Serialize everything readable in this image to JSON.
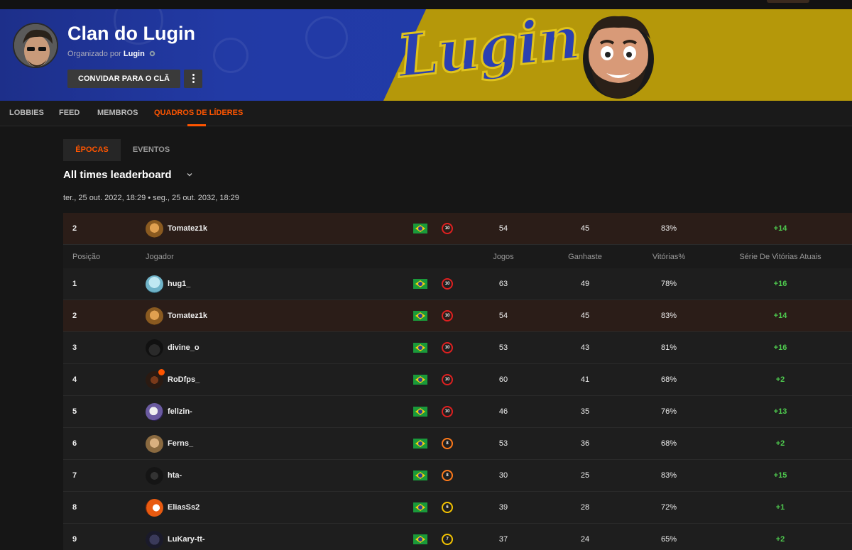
{
  "clan": {
    "title": "Clan do Lugin",
    "organized_by_prefix": "Organizado por",
    "organizer": "Lugin",
    "invite_button": "CONVIDAR PARA O CLÃ",
    "banner_brand": "Lugin"
  },
  "nav": {
    "tabs": [
      {
        "label": "LOBBIES"
      },
      {
        "label": "FEED"
      },
      {
        "label": "MEMBROS"
      },
      {
        "label": "QUADROS DE LÍDERES"
      }
    ],
    "active": "QUADROS DE LÍDERES"
  },
  "subtabs": [
    {
      "label": "ÉPOCAS"
    },
    {
      "label": "EVENTOS"
    }
  ],
  "leaderboard": {
    "title": "All times leaderboard",
    "range": "ter., 25 out. 2022, 18:29 • seg., 25 out. 2032, 18:29",
    "columns": {
      "position": "Posição",
      "player": "Jogador",
      "games": "Jogos",
      "won": "Ganhaste",
      "win_pct": "Vitórias%",
      "streak": "Série De Vitórias Atuais"
    },
    "current_user": {
      "pos": "2",
      "name": "Tomatez1k",
      "level": "10",
      "games": "54",
      "won": "45",
      "pct": "83%",
      "streak": "+14"
    },
    "rows": [
      {
        "pos": "1",
        "name": "hug1_",
        "level": "10",
        "games": "63",
        "won": "49",
        "pct": "78%",
        "streak": "+16"
      },
      {
        "pos": "2",
        "name": "Tomatez1k",
        "level": "10",
        "games": "54",
        "won": "45",
        "pct": "83%",
        "streak": "+14"
      },
      {
        "pos": "3",
        "name": "divine_o",
        "level": "10",
        "games": "53",
        "won": "43",
        "pct": "81%",
        "streak": "+16"
      },
      {
        "pos": "4",
        "name": "RoDfps_",
        "level": "10",
        "games": "60",
        "won": "41",
        "pct": "68%",
        "streak": "+2"
      },
      {
        "pos": "5",
        "name": "fellzin-",
        "level": "10",
        "games": "46",
        "won": "35",
        "pct": "76%",
        "streak": "+13"
      },
      {
        "pos": "6",
        "name": "Ferns_",
        "level": "8",
        "games": "53",
        "won": "36",
        "pct": "68%",
        "streak": "+2"
      },
      {
        "pos": "7",
        "name": "hta-",
        "level": "8",
        "games": "30",
        "won": "25",
        "pct": "83%",
        "streak": "+15"
      },
      {
        "pos": "8",
        "name": "EliasSs2",
        "level": "6",
        "games": "39",
        "won": "28",
        "pct": "72%",
        "streak": "+1"
      },
      {
        "pos": "9",
        "name": "LuKary-tt-",
        "level": "7",
        "games": "37",
        "won": "24",
        "pct": "65%",
        "streak": "+2"
      }
    ]
  },
  "colors": {
    "accent": "#ff5500",
    "streak_green": "#4ec94e",
    "level_red": "#e02020",
    "level_orange": "#ff7a1a",
    "level_yellow": "#f5c400",
    "banner_blue": "#223aa5",
    "banner_yellow": "#b5980a"
  },
  "icons": {
    "more": "more-vertical-icon",
    "verified": "gear-badge-icon",
    "chevron": "chevron-down-icon",
    "flag": "brazil-flag-icon"
  }
}
